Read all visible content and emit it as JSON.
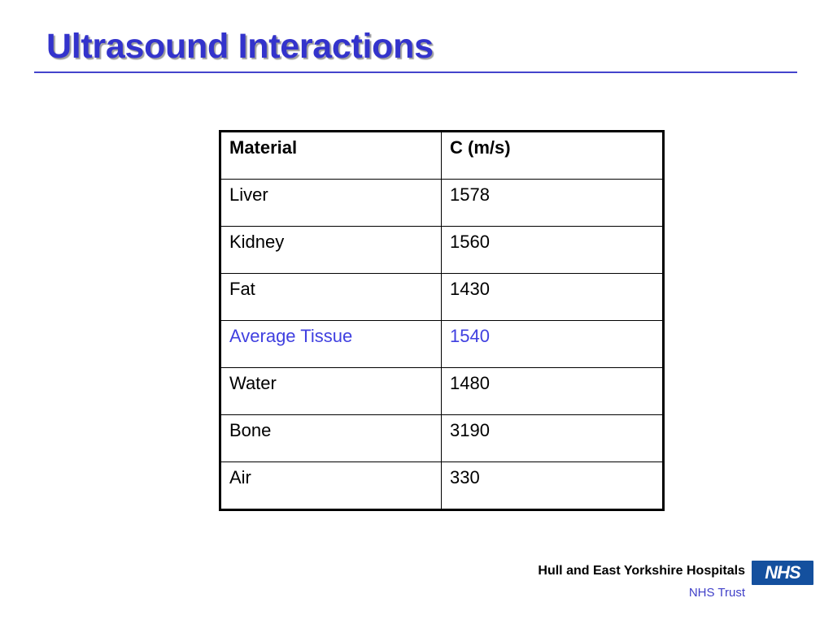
{
  "slide": {
    "title": "Ultrasound Interactions",
    "background_color": "#ffffff",
    "title_color": "#3333cc",
    "rule_color": "#4444cc",
    "highlight_color": "#4040e0"
  },
  "table": {
    "columns": [
      "Material",
      "C (m/s)"
    ],
    "rows": [
      {
        "material": "Liver",
        "speed": "1578",
        "highlight": false
      },
      {
        "material": "Kidney",
        "speed": "1560",
        "highlight": false
      },
      {
        "material": "Fat",
        "speed": "1430",
        "highlight": false
      },
      {
        "material": "Average Tissue",
        "speed": "1540",
        "highlight": true
      },
      {
        "material": "Water",
        "speed": "1480",
        "highlight": false
      },
      {
        "material": "Bone",
        "speed": "3190",
        "highlight": false
      },
      {
        "material": "Air",
        "speed": "330",
        "highlight": false
      }
    ]
  },
  "footer": {
    "trust_name": "Hull and East Yorkshire Hospitals",
    "trust_subtitle": "NHS Trust",
    "logo_text": "NHS",
    "logo_color": "#14509e"
  },
  "chart_data": {
    "type": "table",
    "title": "Ultrasound Interactions",
    "columns": [
      "Material",
      "C (m/s)"
    ],
    "categories": [
      "Liver",
      "Kidney",
      "Fat",
      "Average Tissue",
      "Water",
      "Bone",
      "Air"
    ],
    "values": [
      1578,
      1560,
      1430,
      1540,
      1480,
      3190,
      330
    ],
    "xlabel": "Material",
    "ylabel": "C (m/s)",
    "units": "m/s",
    "highlighted": [
      "Average Tissue"
    ]
  }
}
